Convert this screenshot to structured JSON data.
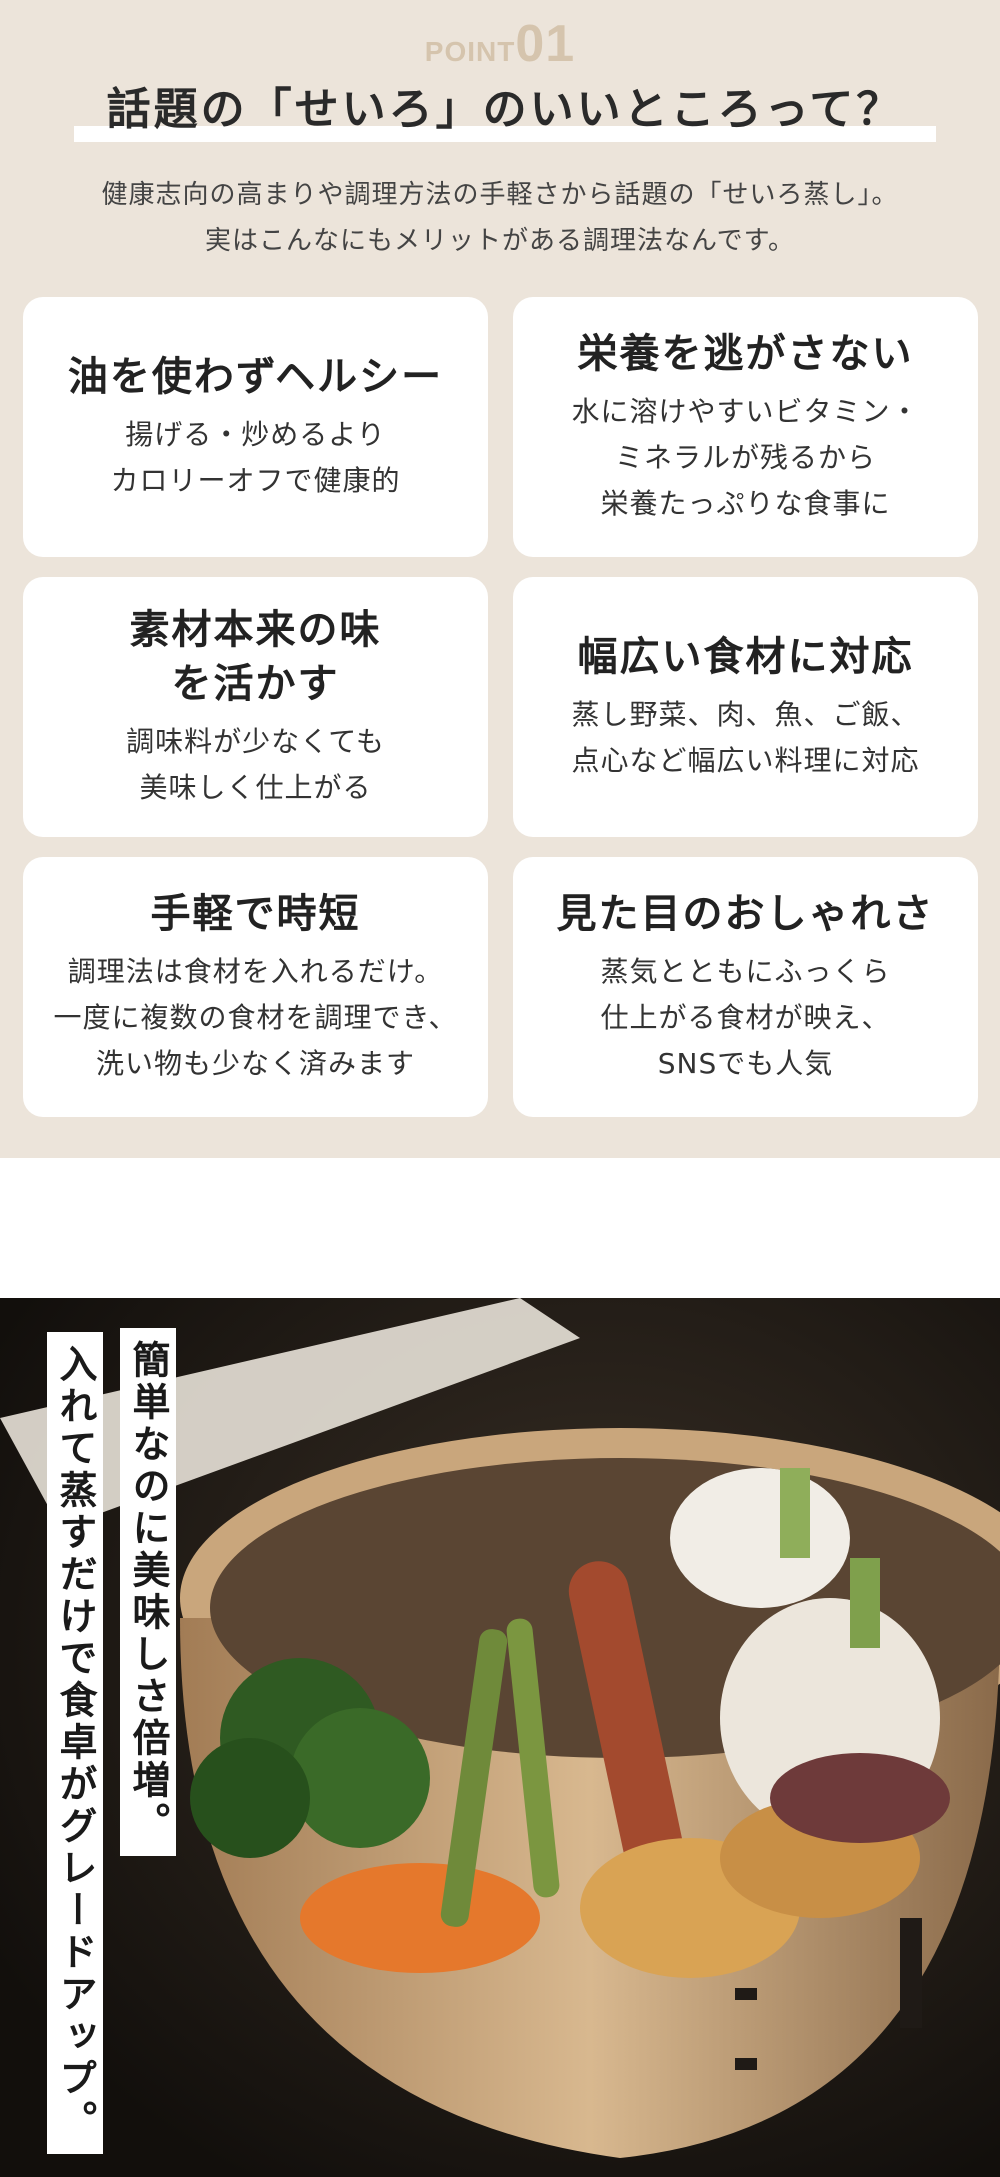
{
  "point": {
    "word": "POINT",
    "number": "01"
  },
  "heading": "話題の「せいろ」のいいところって？",
  "intro": {
    "line1": "健康志向の高まりや調理方法の手軽さから話題の「せいろ蒸し」。",
    "line2": "実はこんなにもメリットがある調理法なんです。"
  },
  "cards": [
    {
      "title": "油を使わずヘルシー",
      "desc": "揚げる・炒めるより\nカロリーオフで健康的"
    },
    {
      "title": "栄養を逃がさない",
      "desc": "水に溶けやすいビタミン・\nミネラルが残るから\n栄養たっぷりな食事に"
    },
    {
      "title": "素材本来の味\nを活かす",
      "desc": "調味料が少なくても\n美味しく仕上がる"
    },
    {
      "title": "幅広い食材に対応",
      "desc": "蒸し野菜、肉、魚、ご飯、\n点心など幅広い料理に対応"
    },
    {
      "title": "手軽で時短",
      "desc": "調理法は食材を入れるだけ。\n一度に複数の食材を調理でき、\n洗い物も少なく済みます"
    },
    {
      "title": "見た目のおしゃれさ",
      "desc": "蒸気とともにふっくら\n仕上がる食材が映え、\nSNSでも人気"
    }
  ],
  "photo": {
    "caption_right": "簡単なのに美味しさ倍増。",
    "caption_left": "入れて蒸すだけで食卓がグレードアップ。"
  },
  "colors": {
    "background": "#ece4da",
    "point_accent": "#d5c4ad",
    "card": "#ffffff"
  }
}
